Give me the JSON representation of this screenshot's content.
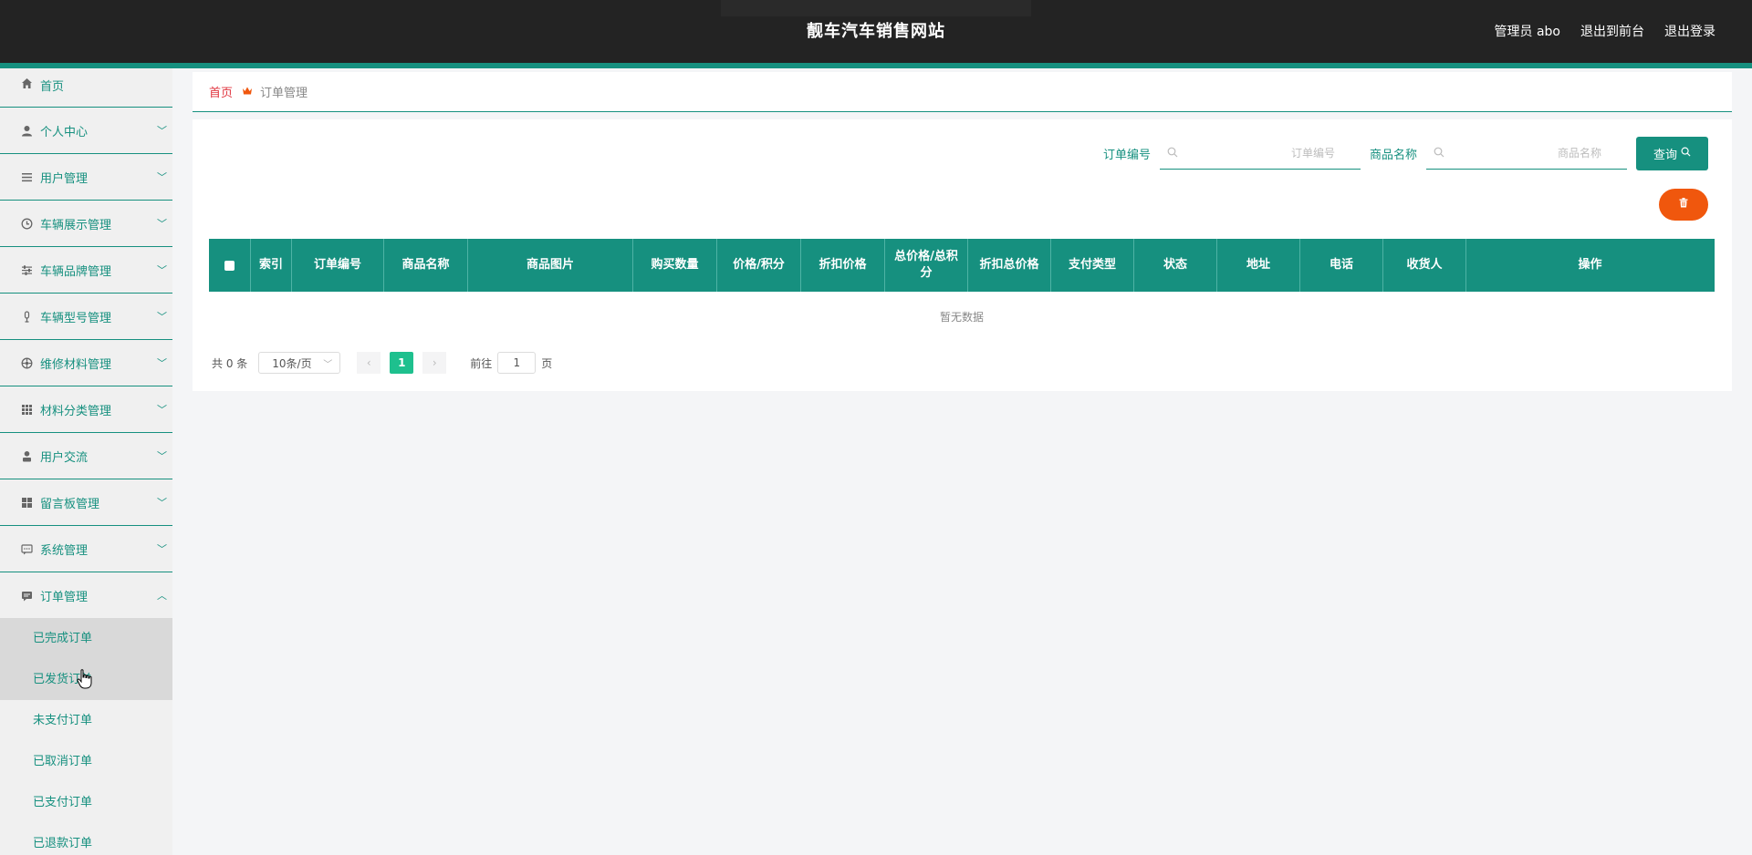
{
  "header": {
    "title": "靓车汽车销售网站",
    "links": [
      "管理员 abo",
      "退出到前台",
      "退出登录"
    ]
  },
  "sidebar": {
    "items": [
      {
        "label": "首页",
        "icon": "home-icon"
      },
      {
        "label": "个人中心",
        "icon": "user-icon"
      },
      {
        "label": "用户管理",
        "icon": "list-icon"
      },
      {
        "label": "车辆展示管理",
        "icon": "clock-icon"
      },
      {
        "label": "车辆品牌管理",
        "icon": "sliders-icon"
      },
      {
        "label": "车辆型号管理",
        "icon": "mic-icon"
      },
      {
        "label": "维修材料管理",
        "icon": "aperture-icon"
      },
      {
        "label": "材料分类管理",
        "icon": "grid-icon"
      },
      {
        "label": "用户交流",
        "icon": "person-icon"
      },
      {
        "label": "留言板管理",
        "icon": "tiles-icon"
      },
      {
        "label": "系统管理",
        "icon": "chat-icon"
      },
      {
        "label": "订单管理",
        "icon": "message-icon"
      }
    ],
    "order_submenu": [
      "已完成订单",
      "已发货订单",
      "未支付订单",
      "已取消订单",
      "已支付订单",
      "已退款订单"
    ]
  },
  "breadcrumb": {
    "home": "首页",
    "current": "订单管理"
  },
  "search": {
    "order_no_label": "订单编号",
    "order_no_placeholder": "订单编号",
    "product_name_label": "商品名称",
    "product_name_placeholder": "商品名称",
    "query_label": "查询"
  },
  "table": {
    "columns": [
      "索引",
      "订单编号",
      "商品名称",
      "商品图片",
      "购买数量",
      "价格/积分",
      "折扣价格",
      "总价格/总积分",
      "折扣总价格",
      "支付类型",
      "状态",
      "地址",
      "电话",
      "收货人",
      "操作"
    ],
    "empty_text": "暂无数据"
  },
  "pagination": {
    "total": "共 0 条",
    "page_size": "10条/页",
    "current_page": "1",
    "goto_label": "前往",
    "goto_value": "1",
    "page_unit": "页"
  },
  "colors": {
    "accent": "#16907f",
    "header_bg": "#232323",
    "danger": "#f0570d",
    "page_active": "#1ec08e"
  }
}
